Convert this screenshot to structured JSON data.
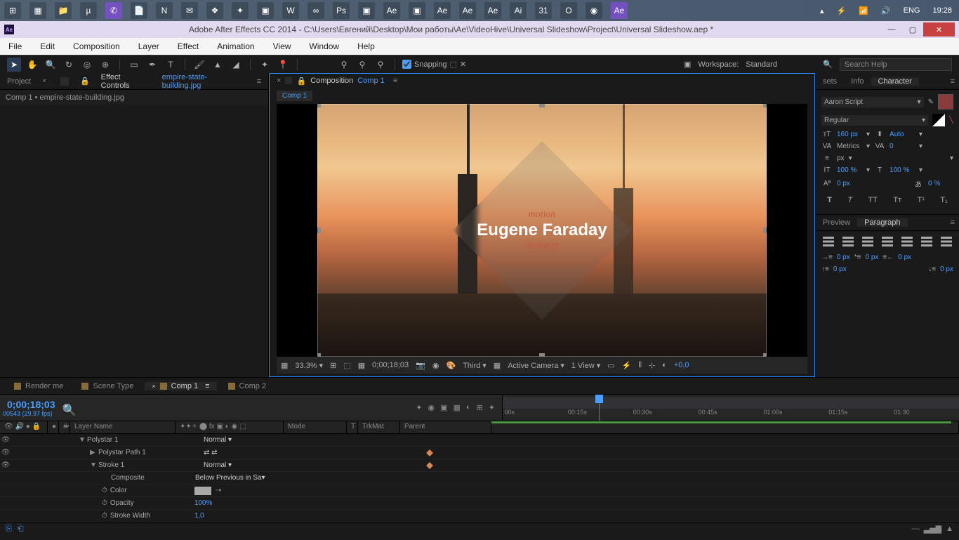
{
  "taskbar": {
    "lang": "ENG",
    "time": "19:28"
  },
  "titlebar": {
    "app_logo": "Ae",
    "title": "Adobe After Effects CC 2014 - C:\\Users\\Евгений\\Desktop\\Мои работы\\Ae\\VideoHive\\Universal Slideshow\\Project\\Universal Slideshow.aep *"
  },
  "menu": [
    "File",
    "Edit",
    "Composition",
    "Layer",
    "Effect",
    "Animation",
    "View",
    "Window",
    "Help"
  ],
  "toolbar": {
    "snapping": "Snapping",
    "workspace_label": "Workspace:",
    "workspace": "Standard",
    "search_placeholder": "Search Help"
  },
  "left": {
    "tab_project": "Project",
    "tab_fx": "Effect Controls",
    "fx_target": "empire-state-building.jpg",
    "breadcrumb": "Comp 1 • empire-state-building.jpg"
  },
  "center": {
    "tab_label": "Composition",
    "comp_name": "Comp 1",
    "overlay": {
      "line1": "motion",
      "line2": "Eugene Faraday",
      "line3": "designer"
    },
    "footer": {
      "zoom": "33.3%",
      "time": "0;00;18;03",
      "res": "Third",
      "camera": "Active Camera",
      "view": "1 View",
      "exp": "+0,0"
    }
  },
  "right": {
    "tabs": {
      "presets": "sets",
      "info": "Info",
      "character": "Character"
    },
    "char": {
      "font": "Aaron Script",
      "style": "Regular",
      "size": "160 px",
      "leading": "Auto",
      "kerning": "Metrics",
      "tracking": "0",
      "unit": "px",
      "vscale": "100 %",
      "hscale": "100 %",
      "baseline": "0 px",
      "tsume": "0 %"
    },
    "para_tabs": {
      "preview": "Preview",
      "paragraph": "Paragraph"
    },
    "para": {
      "left": "0 px",
      "right": "0 px",
      "first": "0 px",
      "before": "0 px",
      "after": "0 px"
    }
  },
  "timeline": {
    "tabs": [
      "Render me",
      "Scene Type",
      "Comp 1",
      "Comp 2"
    ],
    "timecode": "0;00;18;03",
    "frame_info": "00543 (29.97 fps)",
    "cols": {
      "num": "#",
      "layer": "Layer Name",
      "mode": "Mode",
      "trkmat": "TrkMat",
      "parent": "Parent",
      "t": "T"
    },
    "ruler": [
      ":00s",
      "00:15s",
      "00:30s",
      "00:45s",
      "01:00s",
      "01:15s",
      "01:30"
    ],
    "layers": {
      "polystar": "Polystar 1",
      "polystar_path": "Polystar Path 1",
      "stroke": "Stroke 1",
      "composite": "Composite",
      "composite_val": "Below Previous in Sa",
      "color": "Color",
      "opacity": "Opacity",
      "opacity_val": "100%",
      "stroke_width": "Stroke Width",
      "stroke_width_val": "1,0",
      "normal": "Normal"
    }
  }
}
